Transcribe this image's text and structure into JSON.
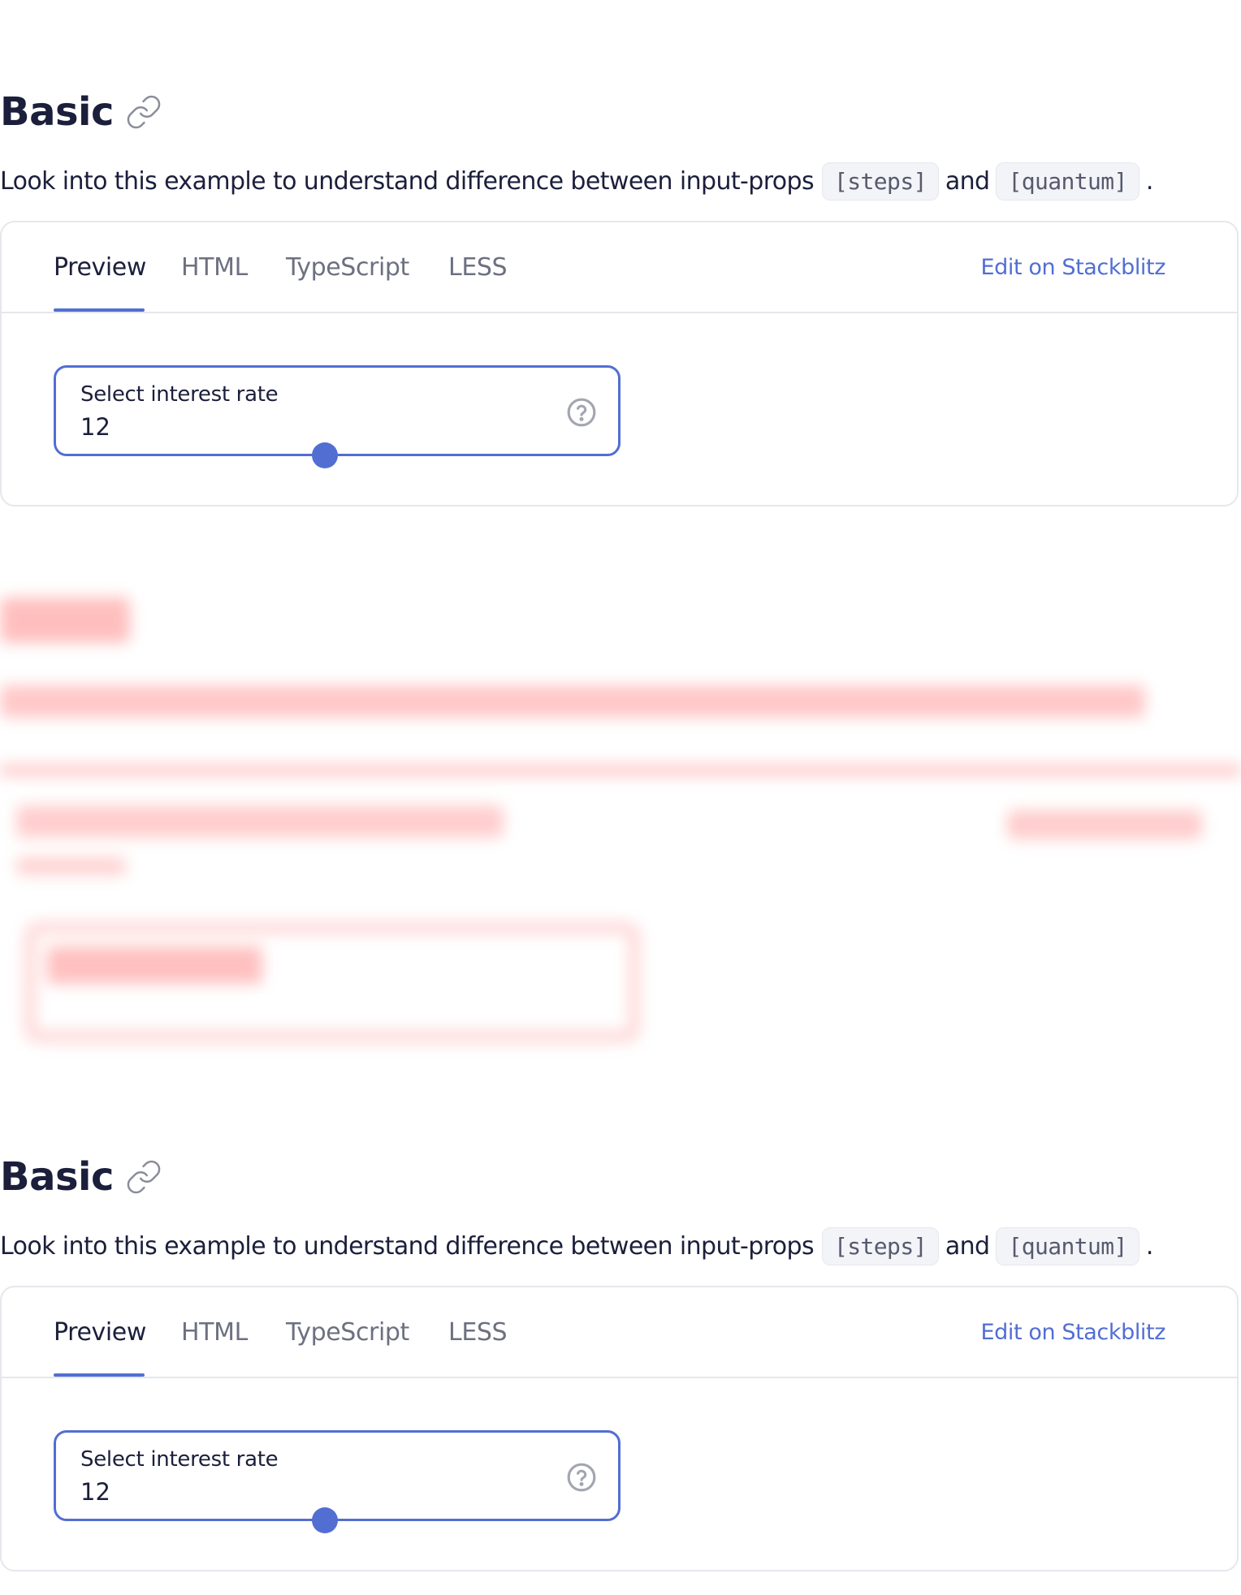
{
  "sections": [
    {
      "title": "Basic",
      "description": {
        "prefix": "Look into this example to understand difference between input-props",
        "code1": "[steps]",
        "middle": "and",
        "code2": "[quantum]",
        "suffix": "."
      },
      "tabs": [
        "Preview",
        "HTML",
        "TypeScript",
        "LESS"
      ],
      "active_tab": "Preview",
      "edit_link": "Edit on Stackblitz",
      "field": {
        "label": "Select interest rate",
        "value": "12",
        "slider_fraction": 0.478
      }
    },
    {
      "title": "Basic",
      "description": {
        "prefix": "Look into this example to understand difference between input-props",
        "code1": "[steps]",
        "middle": "and",
        "code2": "[quantum]",
        "suffix": "."
      },
      "tabs": [
        "Preview",
        "HTML",
        "TypeScript",
        "LESS"
      ],
      "active_tab": "Preview",
      "edit_link": "Edit on Stackblitz",
      "field": {
        "label": "Select interest rate",
        "value": "12",
        "slider_fraction": 0.478
      }
    }
  ],
  "icons": {
    "anchor": "link-icon",
    "help": "question-circle-icon"
  },
  "colors": {
    "accent": "#526ed3",
    "text": "#1b1f3b",
    "muted": "#6c7080",
    "border": "#e5e7ec",
    "ghost": "#ff8a8a"
  }
}
